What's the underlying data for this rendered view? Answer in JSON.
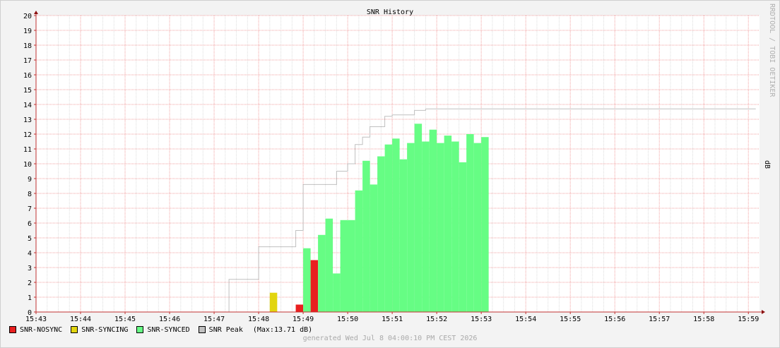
{
  "chart_data": {
    "type": "area",
    "title": "SNR History",
    "ylabel": "dB",
    "watermark": "RRDTOOL / TOBI OETIKER",
    "x_ticks": [
      "15:43",
      "15:44",
      "15:45",
      "15:46",
      "15:47",
      "15:48",
      "15:49",
      "15:50",
      "15:51",
      "15:52",
      "15:53",
      "15:54",
      "15:55",
      "15:56",
      "15:57",
      "15:58",
      "15:59"
    ],
    "xlim": [
      "15:43",
      "15:59:15"
    ],
    "y_ticks": [
      0,
      1,
      2,
      3,
      4,
      5,
      6,
      7,
      8,
      9,
      10,
      11,
      12,
      13,
      14,
      15,
      16,
      17,
      18,
      19,
      20
    ],
    "ylim": [
      0,
      20
    ],
    "grid": true,
    "series": [
      {
        "name": "SNR-NOSYNC",
        "color": "#e91f1f",
        "kind": "bars",
        "points": [
          {
            "start": "15:48:50",
            "end": "15:49:00",
            "value": 0.5
          },
          {
            "start": "15:49:10",
            "end": "15:49:20",
            "value": 3.5
          }
        ]
      },
      {
        "name": "SNR-SYNCING",
        "color": "#e2d50f",
        "kind": "bars",
        "points": [
          {
            "start": "15:48:15",
            "end": "15:48:25",
            "value": 1.3
          }
        ]
      },
      {
        "name": "SNR-SYNCED",
        "color": "#66fd84",
        "kind": "bars",
        "points": [
          {
            "start": "15:49:00",
            "end": "15:49:10",
            "value": 4.3
          },
          {
            "start": "15:49:20",
            "end": "15:49:30",
            "value": 5.2
          },
          {
            "start": "15:49:30",
            "end": "15:49:40",
            "value": 6.3
          },
          {
            "start": "15:49:40",
            "end": "15:49:50",
            "value": 2.6
          },
          {
            "start": "15:49:50",
            "end": "15:50:10",
            "value": 6.2
          },
          {
            "start": "15:50:10",
            "end": "15:50:20",
            "value": 8.2
          },
          {
            "start": "15:50:20",
            "end": "15:50:30",
            "value": 10.2
          },
          {
            "start": "15:50:30",
            "end": "15:50:40",
            "value": 8.6
          },
          {
            "start": "15:50:40",
            "end": "15:50:50",
            "value": 10.5
          },
          {
            "start": "15:50:50",
            "end": "15:51:00",
            "value": 11.3
          },
          {
            "start": "15:51:00",
            "end": "15:51:10",
            "value": 11.7
          },
          {
            "start": "15:51:10",
            "end": "15:51:20",
            "value": 10.3
          },
          {
            "start": "15:51:20",
            "end": "15:51:30",
            "value": 11.4
          },
          {
            "start": "15:51:30",
            "end": "15:51:40",
            "value": 12.7
          },
          {
            "start": "15:51:40",
            "end": "15:51:50",
            "value": 11.5
          },
          {
            "start": "15:51:50",
            "end": "15:52:00",
            "value": 12.3
          },
          {
            "start": "15:52:00",
            "end": "15:52:10",
            "value": 11.4
          },
          {
            "start": "15:52:10",
            "end": "15:52:20",
            "value": 11.9
          },
          {
            "start": "15:52:20",
            "end": "15:52:30",
            "value": 11.5
          },
          {
            "start": "15:52:30",
            "end": "15:52:40",
            "value": 10.1
          },
          {
            "start": "15:52:40",
            "end": "15:52:50",
            "value": 12.0
          },
          {
            "start": "15:52:50",
            "end": "15:53:00",
            "value": 11.4
          },
          {
            "start": "15:53:00",
            "end": "15:53:10",
            "value": 11.8
          }
        ]
      },
      {
        "name": "SNR Peak",
        "color": "#c0c0c0",
        "kind": "step",
        "points": [
          [
            "15:47:20",
            0
          ],
          [
            "15:47:20",
            2.2
          ],
          [
            "15:48:00",
            2.2
          ],
          [
            "15:48:00",
            4.4
          ],
          [
            "15:48:50",
            4.4
          ],
          [
            "15:48:50",
            5.5
          ],
          [
            "15:49:00",
            5.5
          ],
          [
            "15:49:00",
            8.6
          ],
          [
            "15:49:45",
            8.6
          ],
          [
            "15:49:45",
            9.5
          ],
          [
            "15:50:00",
            9.5
          ],
          [
            "15:50:00",
            10.0
          ],
          [
            "15:50:10",
            10.0
          ],
          [
            "15:50:10",
            11.3
          ],
          [
            "15:50:20",
            11.3
          ],
          [
            "15:50:20",
            11.8
          ],
          [
            "15:50:30",
            11.8
          ],
          [
            "15:50:30",
            12.5
          ],
          [
            "15:50:50",
            12.5
          ],
          [
            "15:50:50",
            13.2
          ],
          [
            "15:51:00",
            13.2
          ],
          [
            "15:51:00",
            13.3
          ],
          [
            "15:51:30",
            13.3
          ],
          [
            "15:51:30",
            13.6
          ],
          [
            "15:51:45",
            13.6
          ],
          [
            "15:51:45",
            13.7
          ],
          [
            "15:59:10",
            13.7
          ]
        ]
      }
    ],
    "peak_note": "(Max:13.71 dB)"
  },
  "footer": {
    "generated": "generated Wed Jul  8 04:00:10 PM CEST 2026"
  }
}
